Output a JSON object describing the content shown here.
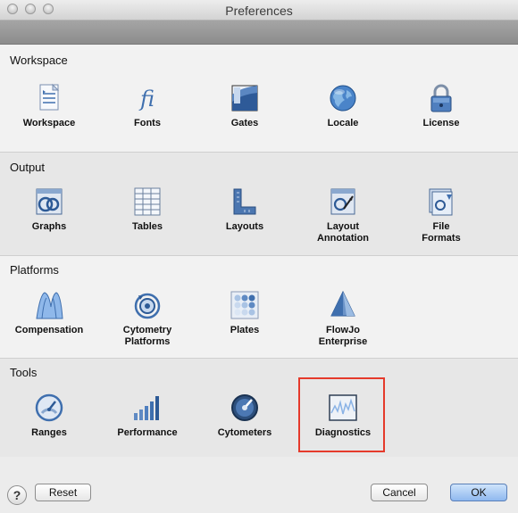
{
  "window": {
    "title": "Preferences"
  },
  "sections": {
    "workspace": {
      "title": "Workspace",
      "items": [
        {
          "label": "Workspace",
          "icon": "workspace-icon"
        },
        {
          "label": "Fonts",
          "icon": "fonts-icon"
        },
        {
          "label": "Gates",
          "icon": "gates-icon"
        },
        {
          "label": "Locale",
          "icon": "globe-icon"
        },
        {
          "label": "License",
          "icon": "lock-icon"
        }
      ]
    },
    "output": {
      "title": "Output",
      "items": [
        {
          "label": "Graphs",
          "icon": "graphs-icon"
        },
        {
          "label": "Tables",
          "icon": "tables-icon"
        },
        {
          "label": "Layouts",
          "icon": "layouts-icon"
        },
        {
          "label": "Layout\nAnnotation",
          "icon": "layout-annotation-icon"
        },
        {
          "label": "File\nFormats",
          "icon": "file-formats-icon"
        }
      ]
    },
    "platforms": {
      "title": "Platforms",
      "items": [
        {
          "label": "Compensation",
          "icon": "compensation-icon"
        },
        {
          "label": "Cytometry\nPlatforms",
          "icon": "cytometry-platforms-icon"
        },
        {
          "label": "Plates",
          "icon": "plates-icon"
        },
        {
          "label": "FlowJo\nEnterprise",
          "icon": "flowjo-enterprise-icon"
        }
      ]
    },
    "tools": {
      "title": "Tools",
      "items": [
        {
          "label": "Ranges",
          "icon": "ranges-icon"
        },
        {
          "label": "Performance",
          "icon": "performance-icon"
        },
        {
          "label": "Cytometers",
          "icon": "cytometers-icon"
        },
        {
          "label": "Diagnostics",
          "icon": "diagnostics-icon"
        }
      ]
    }
  },
  "footer": {
    "help_label": "?",
    "reset_label": "Reset",
    "cancel_label": "Cancel",
    "ok_label": "OK"
  },
  "colors": {
    "highlight": "#e53a2b",
    "icon_blue": "#3f6fae",
    "ok_button": "#8fb8ef"
  }
}
